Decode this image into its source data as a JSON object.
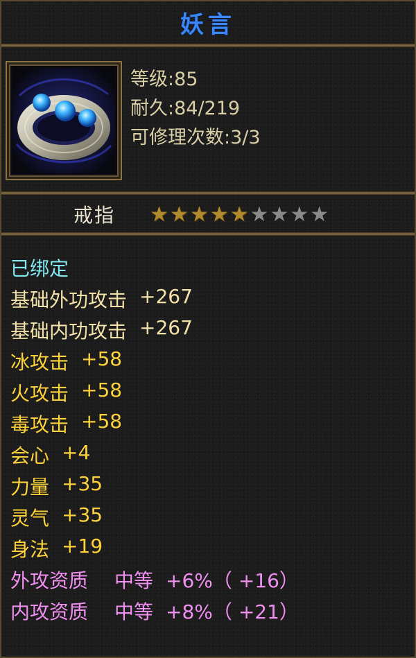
{
  "item": {
    "name": "妖言",
    "level_text": "等级:85",
    "durability_text": "耐久:84/219",
    "repair_text": "可修理次数:3/3",
    "type": "戒指",
    "stars": {
      "filled": 5,
      "total": 9
    },
    "icon": "ring-with-blue-gems-icon"
  },
  "colors": {
    "title": "#3a86ff",
    "bound": "#7fe8f0",
    "base_stat": "#f3e2a8",
    "bonus_stat": "#ffd23a",
    "quality_stat": "#f08ff0",
    "star_filled": "#b08a2c",
    "star_empty": "#8a8a8a",
    "frame_gold": "#8c7448"
  },
  "bound_label": "已绑定",
  "stats": [
    {
      "name": "基础外功攻击",
      "value": "+267",
      "color": "base"
    },
    {
      "name": "基础内功攻击",
      "value": "+267",
      "color": "base"
    },
    {
      "name": "冰攻击",
      "value": "+58",
      "color": "yellow"
    },
    {
      "name": "火攻击",
      "value": "+58",
      "color": "yellow"
    },
    {
      "name": "毒攻击",
      "value": "+58",
      "color": "yellow"
    },
    {
      "name": "会心",
      "value": "+4",
      "color": "yellow"
    },
    {
      "name": "力量",
      "value": "+35",
      "color": "yellow"
    },
    {
      "name": "灵气",
      "value": "+35",
      "color": "yellow"
    },
    {
      "name": "身法",
      "value": "+19",
      "color": "yellow"
    }
  ],
  "qualities": [
    {
      "name": "外攻资质",
      "grade": "中等",
      "value": "+6%（ +16）"
    },
    {
      "name": "内攻资质",
      "grade": "中等",
      "value": "+8%（ +21）"
    }
  ]
}
